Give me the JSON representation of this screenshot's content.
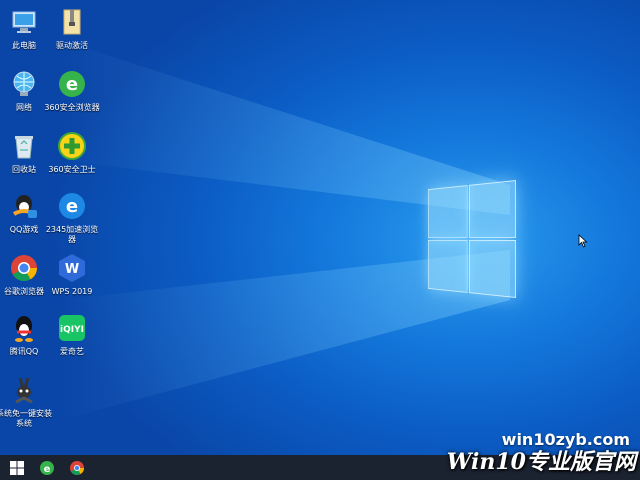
{
  "desktop": {
    "icons": [
      {
        "name": "this-pc",
        "label": "此电脑"
      },
      {
        "name": "driver",
        "label": "驱动激活"
      },
      {
        "name": "network",
        "label": "网络"
      },
      {
        "name": "browser-360",
        "label": "360安全浏览器"
      },
      {
        "name": "recycle-bin",
        "label": "回收站"
      },
      {
        "name": "guard-360",
        "label": "360安全卫士"
      },
      {
        "name": "qq-game",
        "label": "QQ游戏"
      },
      {
        "name": "browser-2345",
        "label": "2345加速浏览器"
      },
      {
        "name": "chrome",
        "label": "谷歌浏览器"
      },
      {
        "name": "wps",
        "label": "WPS 2019"
      },
      {
        "name": "qq",
        "label": "腾讯QQ"
      },
      {
        "name": "iqiyi",
        "label": "爱奇艺"
      },
      {
        "name": "one-key-install",
        "label": "系统免一键安装系统"
      }
    ],
    "watermark_site": "win10zyb.com",
    "watermark_title": "Win10专业版官网"
  },
  "taskbar": {
    "items": [
      "start-button",
      "360-browser-pinned",
      "chrome-pinned"
    ]
  }
}
